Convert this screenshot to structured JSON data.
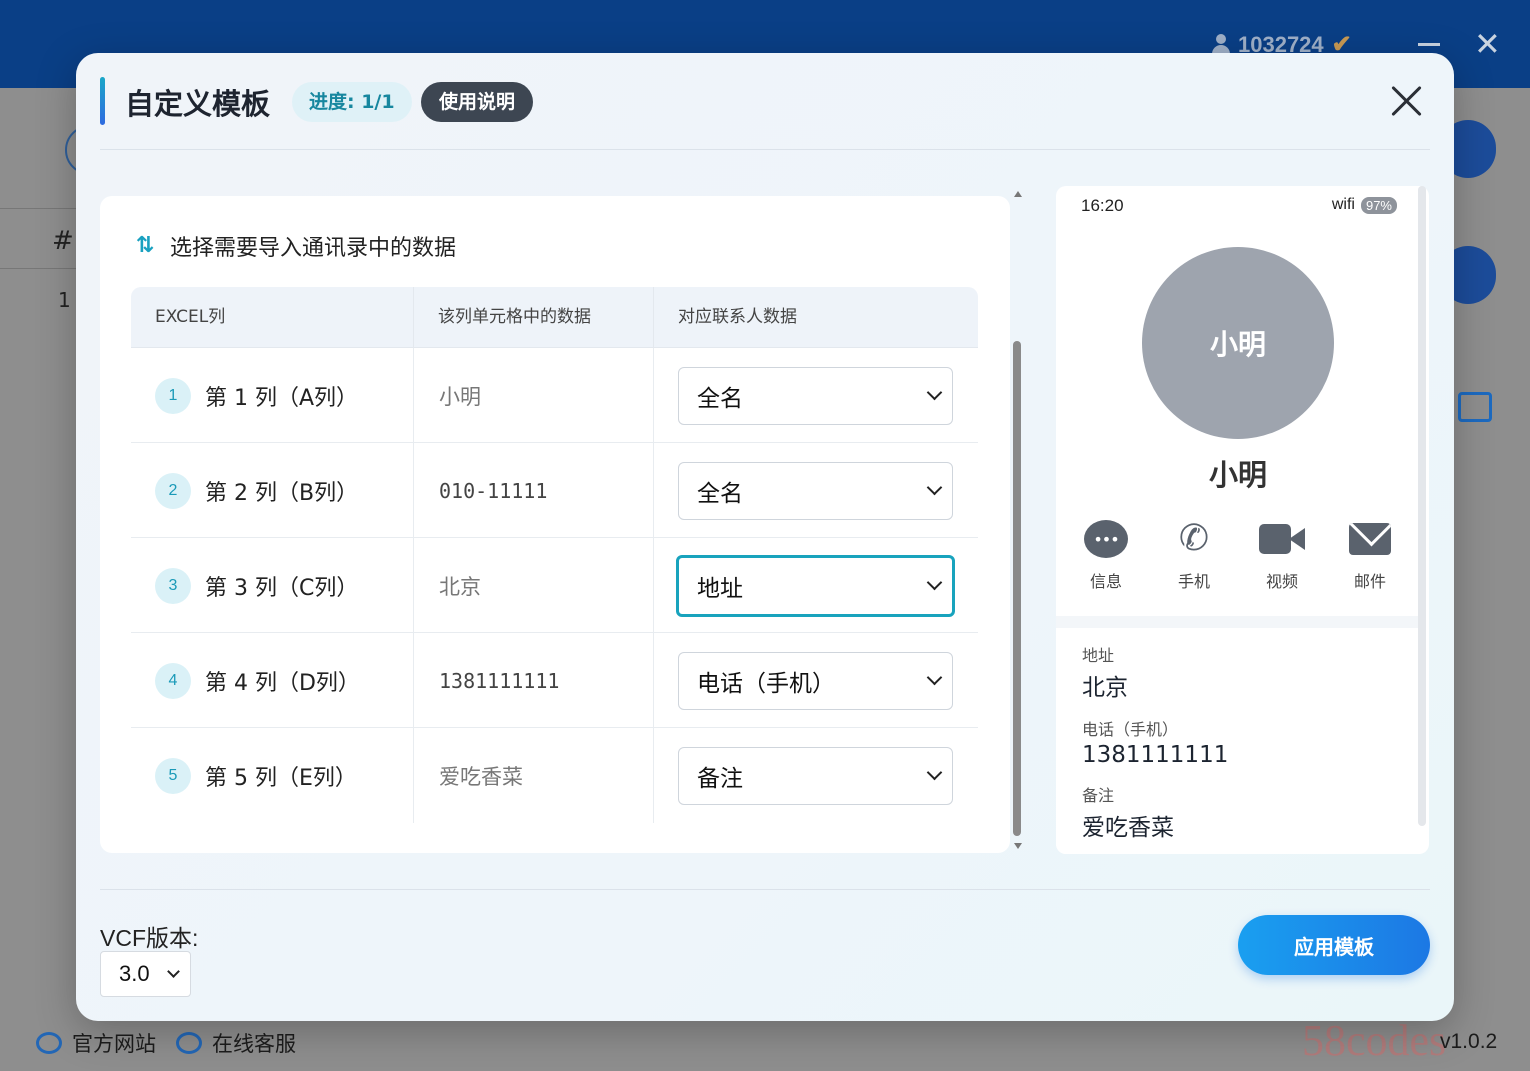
{
  "background": {
    "user_id": "1032724",
    "hash_col": "#",
    "row_num": "1",
    "footer_links": [
      "官方网站",
      "在线客服"
    ],
    "version": "v1.0.2",
    "watermark": "58codes"
  },
  "modal": {
    "title": "自定义模板",
    "progress_badge": "进度: 1/1",
    "guide_badge": "使用说明",
    "section_title": "选择需要导入通讯录中的数据",
    "table": {
      "headers": [
        "EXCEL列",
        "该列单元格中的数据",
        "对应联系人数据"
      ],
      "rows": [
        {
          "num": "1",
          "column": "第 1 列（A列）",
          "cell_data": "小明",
          "mapping": "全名"
        },
        {
          "num": "2",
          "column": "第 2 列（B列）",
          "cell_data": "010-11111",
          "mapping": "全名"
        },
        {
          "num": "3",
          "column": "第 3 列（C列）",
          "cell_data": "北京",
          "mapping": "地址"
        },
        {
          "num": "4",
          "column": "第 4 列（D列）",
          "cell_data": "1381111111",
          "mapping": "电话（手机）"
        },
        {
          "num": "5",
          "column": "第 5 列（E列）",
          "cell_data": "爱吃香菜",
          "mapping": "备注"
        }
      ]
    },
    "preview": {
      "time": "16:20",
      "wifi": "wifi",
      "battery": "97%",
      "avatar_text": "小明",
      "name": "小明",
      "actions": [
        {
          "label": "信息",
          "icon": "message-icon"
        },
        {
          "label": "手机",
          "icon": "phone-icon"
        },
        {
          "label": "视频",
          "icon": "video-icon"
        },
        {
          "label": "邮件",
          "icon": "mail-icon"
        }
      ],
      "fields": [
        {
          "label": "地址",
          "value": "北京"
        },
        {
          "label": "电话（手机）",
          "value": "1381111111"
        },
        {
          "label": "备注",
          "value": "爱吃香菜"
        }
      ]
    },
    "vcf_label": "VCF版本:",
    "vcf_value": "3.0",
    "apply_button": "应用模板"
  }
}
